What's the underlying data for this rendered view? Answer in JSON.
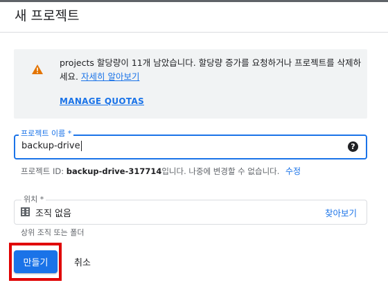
{
  "page": {
    "title": "새 프로젝트"
  },
  "quota_warning": {
    "message": "projects 할당량이 11개 남았습니다. 할당량 증가를 요청하거나 프로젝트를 삭제하세요.",
    "learn_more_label": "자세히 알아보기",
    "manage_quotas_label": "MANAGE QUOTAS",
    "icon": "warning-icon",
    "icon_color": "#e37400"
  },
  "project_name": {
    "label": "프로젝트 이름 *",
    "value": "backup-drive",
    "help_icon": "help-icon"
  },
  "project_id": {
    "prefix": "프로젝트 ID: ",
    "id": "backup-drive-317714",
    "suffix": "입니다. 나중에 변경할 수 없습니다.",
    "edit_label": "수정"
  },
  "location": {
    "label": "위치 *",
    "value": "조직 없음",
    "browse_label": "찾아보기",
    "hint": "상위 조직 또는 폴더",
    "icon": "organization-icon"
  },
  "actions": {
    "create_label": "만들기",
    "cancel_label": "취소"
  },
  "colors": {
    "accent": "#1a73e8",
    "highlight": "#e00000",
    "warning_bg": "#f1f3f4"
  }
}
